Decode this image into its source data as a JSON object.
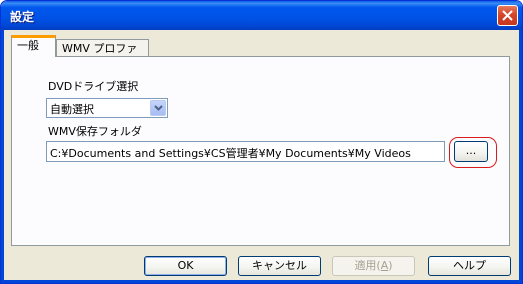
{
  "window": {
    "title": "設定",
    "close_icon": "close-icon"
  },
  "tabs": [
    {
      "label": "一般",
      "active": true
    },
    {
      "label": "WMV プロファイル",
      "active": false
    }
  ],
  "general": {
    "dvd_drive_label": "DVDドライブ選択",
    "dvd_drive_value": "自動選択",
    "wmv_folder_label": "WMV保存フォルダ",
    "wmv_folder_path": "C:¥Documents and Settings¥CS管理者¥My Documents¥My Videos",
    "browse_label": "..."
  },
  "buttons": {
    "ok": "OK",
    "cancel": "キャンセル",
    "apply_text": "適用(",
    "apply_accel": "A",
    "apply_close": ")",
    "help": "ヘルプ"
  },
  "colors": {
    "titlebar": "#0054e3",
    "highlight_ring": "#d81c1c",
    "tab_accent": "#ff9c00"
  }
}
